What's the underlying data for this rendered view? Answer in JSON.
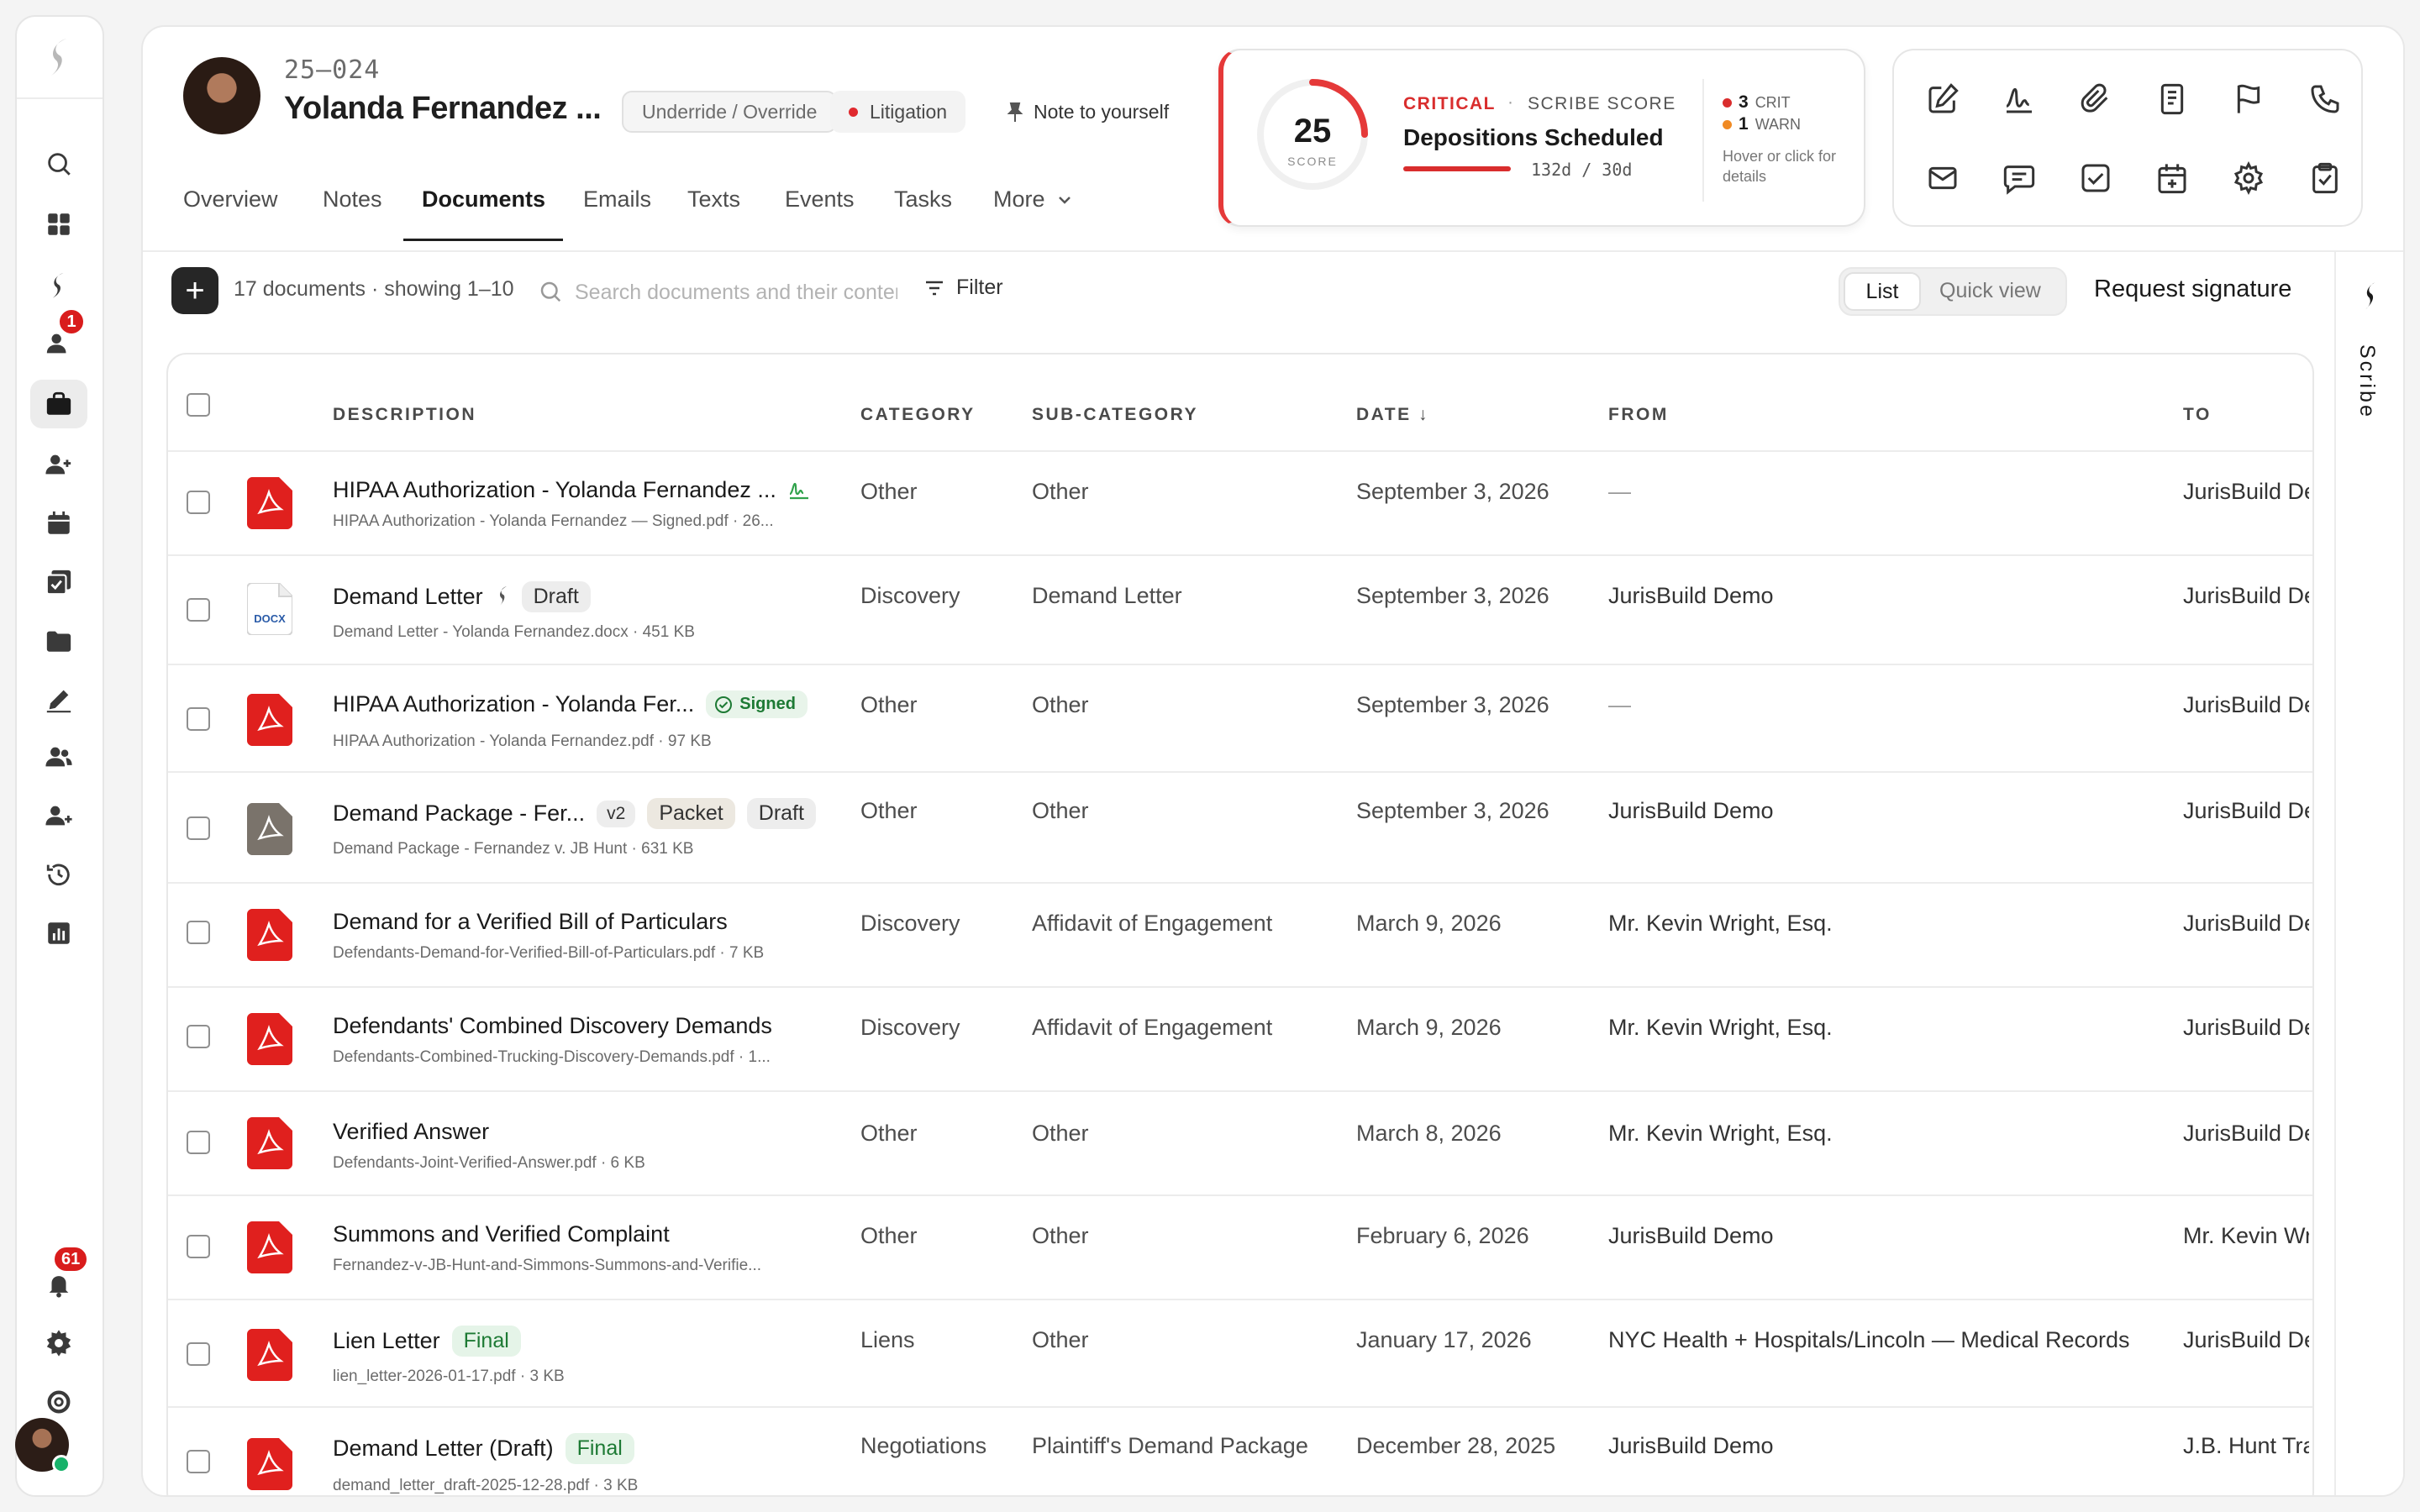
{
  "rail": {
    "notification_badge": "1",
    "bell_badge": "61",
    "icons": [
      "scribe-logo-icon",
      "search-icon",
      "dashboard-icon",
      "scribe-icon",
      "inbox-icon",
      "briefcase-icon",
      "add-person-icon",
      "calendar-icon",
      "tasks-icon",
      "folder-icon",
      "pen-icon",
      "people-icon",
      "add-people-icon",
      "history-icon",
      "reports-icon",
      "bell-icon",
      "settings-icon",
      "help-icon"
    ]
  },
  "header": {
    "case_number": "25–024",
    "client_name": "Yolanda Fernandez ...",
    "chip_underride": "Underride / Override",
    "chip_litigation": "Litigation",
    "note_link": "Note to yourself"
  },
  "tabs": [
    "Overview",
    "Notes",
    "Documents",
    "Emails",
    "Texts",
    "Events",
    "Tasks",
    "More"
  ],
  "active_tab": "Documents",
  "score_card": {
    "score": "25",
    "score_label": "SCORE",
    "severity": "CRITICAL",
    "separator": "·",
    "title": "SCRIBE SCORE",
    "headline": "Depositions Scheduled",
    "days": "132d / 30d",
    "crit_count": "3",
    "crit_label": "CRIT",
    "warn_count": "1",
    "warn_label": "WARN",
    "hint": "Hover or click for details",
    "score_value": 25,
    "colors": {
      "critical": "#d92d2d",
      "warn": "#f08a24"
    }
  },
  "actions": [
    "edit-icon",
    "signature-icon",
    "attachment-icon",
    "document-icon",
    "flag-icon",
    "phone-icon",
    "mail-icon",
    "message-icon",
    "checkbox-icon",
    "calendar-add-icon",
    "gear-icon",
    "clipboard-check-icon"
  ],
  "toolbar": {
    "add_label": "+",
    "count_text": "17 documents · showing 1–10",
    "search_placeholder": "Search documents and their content",
    "filter_label": "Filter",
    "view_list": "List",
    "view_quick": "Quick view",
    "request_signature": "Request signature",
    "scribe_label": "Scribe"
  },
  "table": {
    "headers": {
      "description": "DESCRIPTION",
      "category": "CATEGORY",
      "subcategory": "SUB-CATEGORY",
      "date": "DATE ↓",
      "from": "FROM",
      "to": "TO"
    },
    "rows": [
      {
        "title": "HIPAA Authorization - Yolanda Fernandez ...",
        "sub": "HIPAA Authorization - Yolanda Fernandez — Signed.pdf · 26...",
        "category": "Other",
        "subcategory": "Other",
        "date": "September 3, 2026",
        "from": "—",
        "to": "JurisBuild Demo",
        "icon": "pdf-icon"
      },
      {
        "title": "Demand Letter",
        "badge": "Draft",
        "sub": "Demand Letter - Yolanda Fernandez.docx · 451 KB",
        "category": "Discovery",
        "subcategory": "Demand Letter",
        "date": "September 3, 2026",
        "from": "JurisBuild Demo",
        "to": "JurisBuild Demo",
        "icon": "docx-icon",
        "docx_label": "DOCX"
      },
      {
        "title": "HIPAA Authorization - Yolanda Fer...",
        "badge": "Signed",
        "sub": "HIPAA Authorization - Yolanda Fernandez.pdf · 97 KB",
        "category": "Other",
        "subcategory": "Other",
        "date": "September 3, 2026",
        "from": "—",
        "to": "JurisBuild Demo",
        "icon": "pdf-icon"
      },
      {
        "title": "Demand Package - Fer...",
        "version": "v2",
        "badge": "Packet",
        "badge2": "Draft",
        "sub": "Demand Package - Fernandez v. JB Hunt · 631 KB",
        "category": "Other",
        "subcategory": "Other",
        "date": "September 3, 2026",
        "from": "JurisBuild Demo",
        "to": "JurisBuild Demo",
        "icon": "package-icon"
      },
      {
        "title": "Demand for a Verified Bill of Particulars",
        "sub": "Defendants-Demand-for-Verified-Bill-of-Particulars.pdf · 7 KB",
        "category": "Discovery",
        "subcategory": "Affidavit of Engagement",
        "date": "March 9, 2026",
        "from": "Mr. Kevin Wright, Esq.",
        "to": "JurisBuild Demo",
        "icon": "pdf-icon"
      },
      {
        "title": "Defendants' Combined Discovery Demands",
        "sub": "Defendants-Combined-Trucking-Discovery-Demands.pdf · 1...",
        "category": "Discovery",
        "subcategory": "Affidavit of Engagement",
        "date": "March 9, 2026",
        "from": "Mr. Kevin Wright, Esq.",
        "to": "JurisBuild Demo",
        "icon": "pdf-icon"
      },
      {
        "title": "Verified Answer",
        "sub": "Defendants-Joint-Verified-Answer.pdf · 6 KB",
        "category": "Other",
        "subcategory": "Other",
        "date": "March 8, 2026",
        "from": "Mr. Kevin Wright, Esq.",
        "to": "JurisBuild Demo",
        "icon": "pdf-icon"
      },
      {
        "title": "Summons and Verified Complaint",
        "sub": "Fernandez-v-JB-Hunt-and-Simmons-Summons-and-Verifie...",
        "category": "Other",
        "subcategory": "Other",
        "date": "February 6, 2026",
        "from": "JurisBuild Demo",
        "to": "Mr. Kevin Wright",
        "icon": "pdf-icon"
      },
      {
        "title": "Lien Letter",
        "badge": "Final",
        "sub": "lien_letter-2026-01-17.pdf · 3 KB",
        "category": "Liens",
        "subcategory": "Other",
        "date": "January 17, 2026",
        "from": "NYC Health + Hospitals/Lincoln — Medical Records",
        "to": "JurisBuild Demo",
        "icon": "pdf-icon"
      },
      {
        "title": "Demand Letter (Draft)",
        "badge": "Final",
        "sub": "demand_letter_draft-2025-12-28.pdf · 3 KB",
        "category": "Negotiations",
        "subcategory": "Plaintiff's Demand Package",
        "date": "December 28, 2025",
        "from": "JurisBuild Demo",
        "to": "J.B. Hunt Transport",
        "icon": "pdf-icon"
      }
    ]
  }
}
